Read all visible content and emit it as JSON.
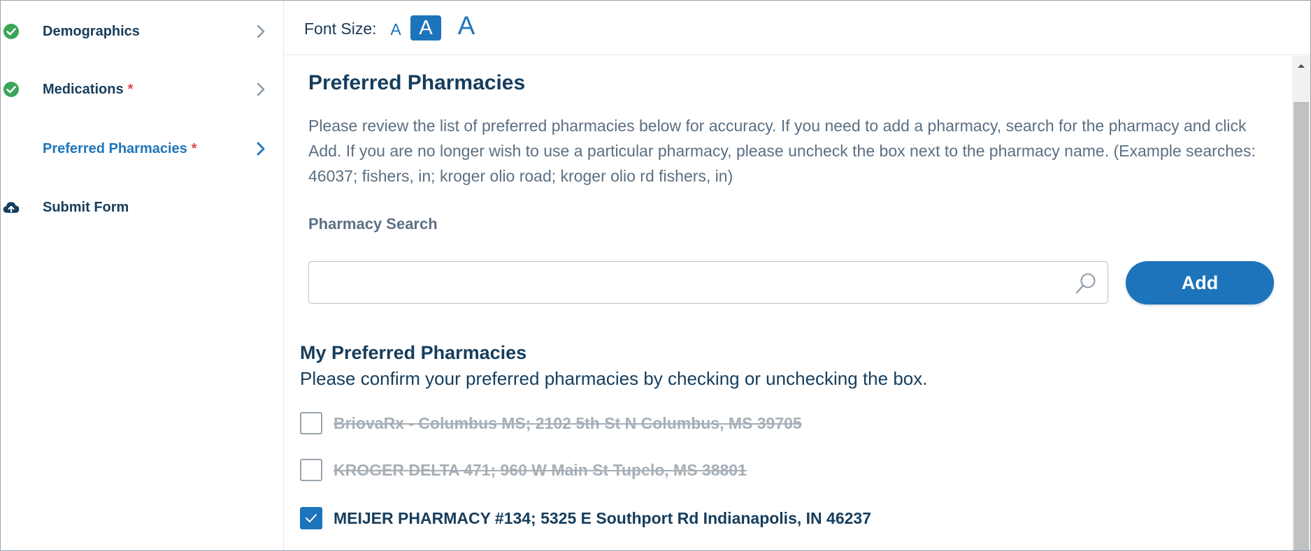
{
  "sidebar": {
    "items": [
      {
        "label": "Demographics",
        "required": "",
        "status": "complete",
        "icon": "check-circle-icon"
      },
      {
        "label": "Medications",
        "required": "*",
        "status": "complete",
        "icon": "check-circle-icon"
      },
      {
        "label": "Preferred Pharmacies",
        "required": "*",
        "status": "active",
        "icon": ""
      },
      {
        "label": "Submit Form",
        "required": "",
        "status": "pending",
        "icon": "cloud-upload-icon"
      }
    ]
  },
  "font_size": {
    "label": "Font Size:",
    "small": "A",
    "medium": "A",
    "large": "A",
    "selected": "medium"
  },
  "main": {
    "title": "Preferred Pharmacies",
    "description": "Please review the list of preferred pharmacies below for accuracy. If you need to add a pharmacy, search for the pharmacy and click Add. If you are no longer wish to use a particular pharmacy, please uncheck the box next to the pharmacy name. (Example searches: 46037; fishers, in; kroger olio road; kroger olio rd fishers, in)",
    "search": {
      "label": "Pharmacy Search",
      "value": "",
      "placeholder": ""
    },
    "add_label": "Add",
    "my_title": "My Preferred Pharmacies",
    "my_subtitle": "Please confirm your preferred pharmacies by checking or unchecking the box.",
    "pharmacies": [
      {
        "label": "BriovaRx - Columbus MS; 2102 5th St N Columbus, MS 39705",
        "checked": false
      },
      {
        "label": "KROGER DELTA 471; 960 W Main St Tupelo, MS 38801",
        "checked": false
      },
      {
        "label": "MEIJER PHARMACY #134; 5325 E Southport Rd Indianapolis, IN 46237",
        "checked": true
      }
    ]
  },
  "colors": {
    "accent": "#1d74bb",
    "complete": "#3aa657",
    "required": "#e0474c",
    "heading": "#163d5c"
  }
}
